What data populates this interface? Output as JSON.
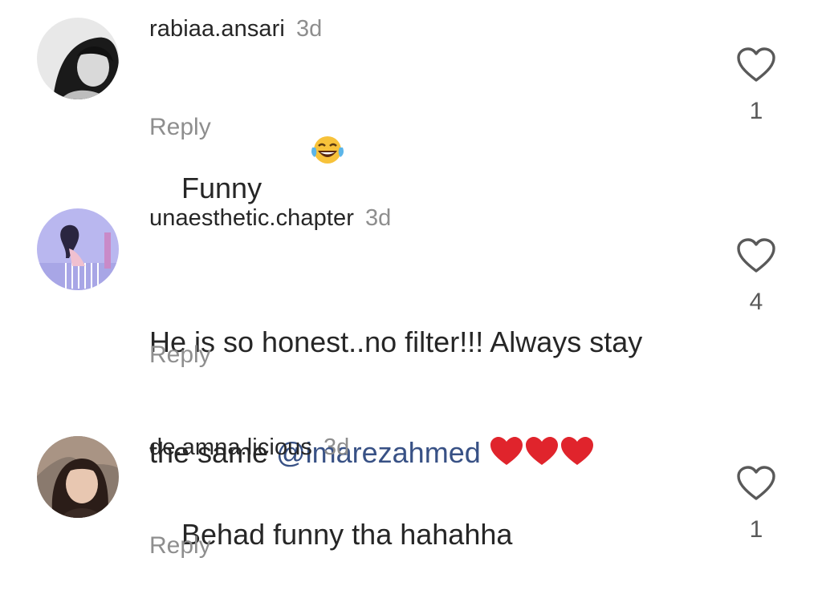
{
  "comments": [
    {
      "username": "rabiaa.ansari",
      "time": "3d",
      "text": "Funny",
      "emoji": "face-with-tears-of-joy",
      "reply_label": "Reply",
      "likes": "1"
    },
    {
      "username": "unaesthetic.chapter",
      "time": "3d",
      "text_line1": "He is so honest..no filter!!! Always stay",
      "text_line2_prefix": "the same ",
      "mention": "@imarezahmed",
      "emoji": "red-heart x3",
      "reply_label": "Reply",
      "likes": "4"
    },
    {
      "username": "de.amna.licious",
      "time": "3d",
      "text": "Behad funny tha hahahha",
      "reply_label": "Reply",
      "likes": "1"
    }
  ],
  "colors": {
    "text": "#262626",
    "muted": "#8e8e8e",
    "mention": "#385185",
    "heart_red": "#e0242c"
  }
}
